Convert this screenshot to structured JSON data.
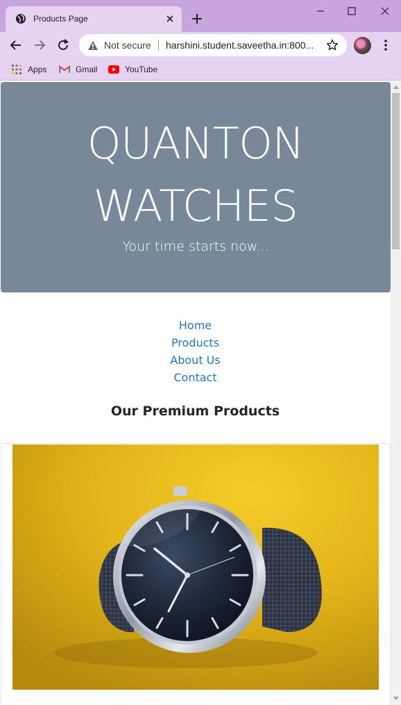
{
  "browser": {
    "tab": {
      "title": "Products Page",
      "favicon": "globe-icon"
    },
    "new_tab_icon": "plus-icon",
    "window_controls": [
      "minimize-icon",
      "maximize-icon",
      "close-icon"
    ],
    "address_bar": {
      "security_label": "Not secure",
      "url": "harshini.student.saveetha.in:800..."
    },
    "bookmarks": [
      {
        "label": "Apps",
        "icon": "apps-grid-icon"
      },
      {
        "label": "Gmail",
        "icon": "gmail-icon"
      },
      {
        "label": "YouTube",
        "icon": "youtube-icon"
      }
    ]
  },
  "page": {
    "hero": {
      "title_line1": "QUANTON",
      "title_line2": "WATCHES",
      "subtitle": "Your time starts now...",
      "background_color": "#778899"
    },
    "nav": {
      "items": [
        {
          "label": "Home"
        },
        {
          "label": "Products"
        },
        {
          "label": "About Us"
        },
        {
          "label": "Contact"
        }
      ],
      "link_color": "#1f78c1"
    },
    "section_title": "Our Premium Products",
    "products": [
      {
        "image": "wristwatch-image"
      }
    ]
  },
  "colors": {
    "chrome_frame": "#c9a5e0",
    "chrome_toolbar": "#e6d3f2"
  }
}
